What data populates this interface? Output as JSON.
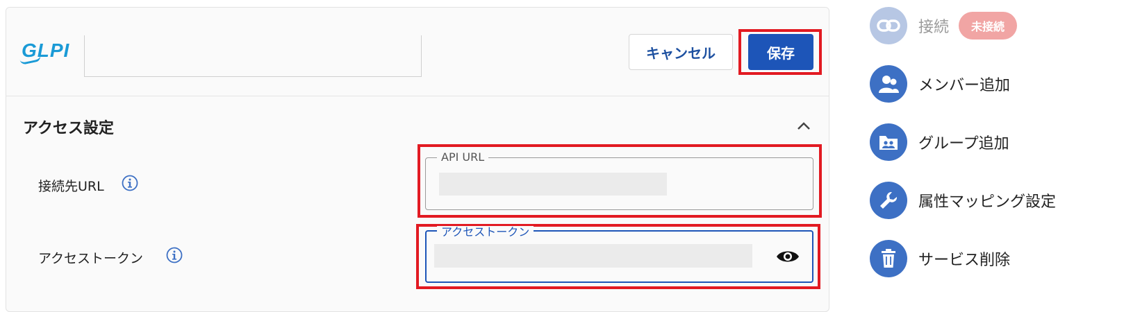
{
  "header": {
    "logo_text": "GLPI",
    "cancel_label": "キャンセル",
    "save_label": "保存"
  },
  "section": {
    "title": "アクセス設定"
  },
  "fields": [
    {
      "label": "接続先URL",
      "legend": "API URL"
    },
    {
      "label": "アクセストークン",
      "legend": "アクセストークン"
    }
  ],
  "sidebar": {
    "items": [
      {
        "label": "接続",
        "icon": "link-icon",
        "badge": "未接続"
      },
      {
        "label": "メンバー追加",
        "icon": "users-icon"
      },
      {
        "label": "グループ追加",
        "icon": "group-folder-icon"
      },
      {
        "label": "属性マッピング設定",
        "icon": "wrench-icon"
      },
      {
        "label": "サービス削除",
        "icon": "trash-icon"
      }
    ]
  },
  "colors": {
    "primary": "#1d55b8",
    "highlight_frame": "#e21a22",
    "badge_bg": "#f1a5a4",
    "logo": "#1a9ad6"
  }
}
